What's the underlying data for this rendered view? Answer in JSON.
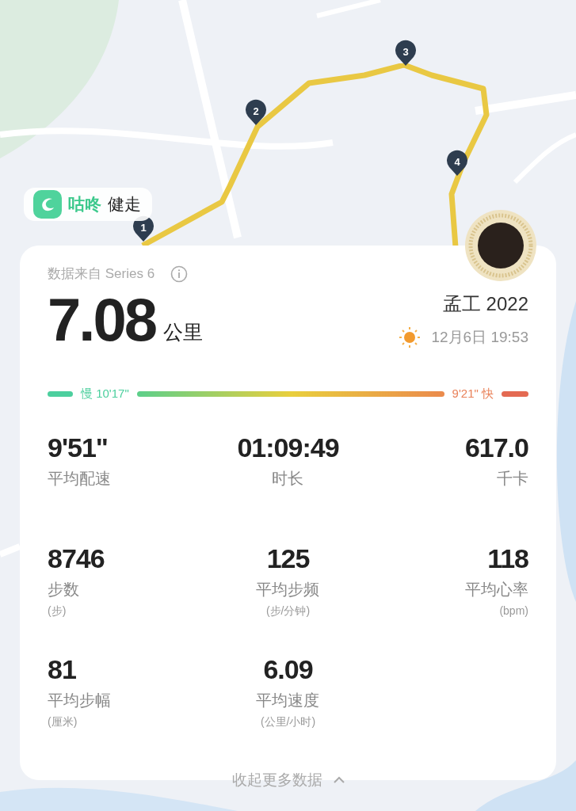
{
  "app_badge": {
    "brand": "咕咚",
    "mode": "健走"
  },
  "route": {
    "markers": [
      "1",
      "2",
      "3",
      "4"
    ]
  },
  "card": {
    "source": "数据来自 Series 6",
    "distance": {
      "value": "7.08",
      "unit": "公里"
    },
    "user": "孟工 2022",
    "date_time": "12月6日 19:53",
    "pace_range": {
      "slow": "慢 10'17\"",
      "fast": "9'21\" 快"
    },
    "stats": [
      {
        "value": "9'51\"",
        "label": "平均配速"
      },
      {
        "value": "01:09:49",
        "label": "时长"
      },
      {
        "value": "617.0",
        "label": "千卡"
      },
      {
        "value": "8746",
        "label": "步数",
        "unit": "(步)"
      },
      {
        "value": "125",
        "label": "平均步频",
        "unit": "(步/分钟)"
      },
      {
        "value": "118",
        "label": "平均心率",
        "unit": "(bpm)"
      },
      {
        "value": "81",
        "label": "平均步幅",
        "unit": "(厘米)"
      },
      {
        "value": "6.09",
        "label": "平均速度",
        "unit": "(公里/小时)"
      }
    ],
    "collapse": "收起更多数据"
  }
}
